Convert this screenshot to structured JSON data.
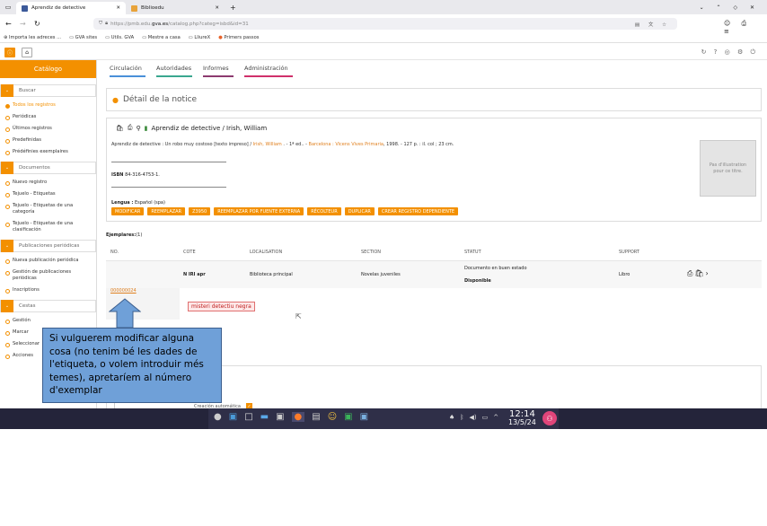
{
  "browser": {
    "tabs": [
      {
        "label": "Aprendiz de detective"
      },
      {
        "label": "Biblioedu"
      }
    ],
    "url_host": "https://pmb.edu.",
    "url_domain": "gva.es",
    "url_path": "/catalog.php?categ=isbd&id=31",
    "bookmarks": [
      "Importa les adreces ...",
      "GVA sites",
      "Utils. GVA",
      "Mestre a casa",
      "LliureX",
      "Primers passos"
    ]
  },
  "sidebar": {
    "catalog_label": "Catálogo",
    "sections": [
      {
        "title": "Buscar",
        "items": [
          "Todos los registros",
          "Periódicas",
          "Últimos registros",
          "Predefinidas",
          "Prédéfinies exemplaires"
        ]
      },
      {
        "title": "Documentos",
        "items": [
          "Nuevo registro",
          "Tejuelo - Etiquetas",
          "Tejuelo - Etiquetas de una categoría",
          "Tejuelo - Etiquetas de una clasificación"
        ]
      },
      {
        "title": "Publicaciones periódicas",
        "items": [
          "Nueva publicación periódica",
          "Gestión de publicaciones periódicas",
          "Inscriptions"
        ]
      },
      {
        "title": "Cestas",
        "items": [
          "Gestión",
          "Marcar",
          "Seleccionar",
          "Acciones"
        ]
      }
    ]
  },
  "topnav": [
    "Circulación",
    "Autoridades",
    "Informes",
    "Administración"
  ],
  "detail": {
    "title": "Détail de la notice",
    "record_title": "Aprendiz de detective / Irish, William",
    "isbd_a": "Aprendiz de detective : Un robo muy costoso [texto impreso] / ",
    "isbd_author": "Irish, William",
    "isbd_b": " . - 1ª ed.. - ",
    "isbd_pub": "Barcelona : Vicens Vives Primaria",
    "isbd_c": ", 1998. - 127 p. : il. col ; 23 cm.",
    "isbn_label": "ISBN",
    "isbn": "84-316-4753-1.",
    "lang_label": "Lengua :",
    "lang": "Español (spa)",
    "buttons": [
      "MODIFICAR",
      "REEMPLAZAR",
      "Z3950",
      "REEMPLAZAR POR FUENTE EXTERNA",
      "RÉCOLTEUR",
      "DUPLICAR",
      "CREAR REGISTRO DEPENDIENTE"
    ],
    "thumb_text": "Pas d'illustration pour ce titre."
  },
  "copies": {
    "label": "Ejemplares:",
    "count": "(1)",
    "headers": [
      "NO.",
      "COTE",
      "LOCALISATION",
      "SECTION",
      "STATUT",
      "SUPPORT"
    ],
    "row": {
      "cote": "N IRI apr",
      "loc": "Biblioteca principal",
      "section": "Novelas juveniles",
      "statut": "Documento en buen estado",
      "avail": "Disponible",
      "support": "Libro",
      "no": "000000024"
    },
    "tag": "misteri detectiu negra"
  },
  "clock": {
    "time": "12:14",
    "date": "13/5/24"
  },
  "note": "Si vulguerem modificar alguna cosa (no tenim bé les dades de l'etiqueta, o volem introduir més temes), apretaríem al número d'exemplar",
  "partial": "Creación automática"
}
